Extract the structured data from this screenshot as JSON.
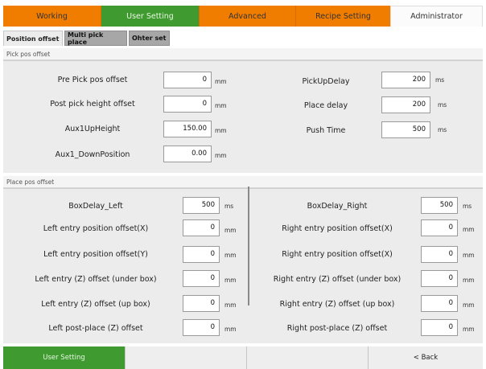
{
  "top_tabs": {
    "working": "Working",
    "user_setting": "User Setting",
    "advanced": "Advanced",
    "recipe_setting": "Recipe Setting",
    "administrator": "Administrator"
  },
  "sub_tabs": {
    "position_offset": "Position offset",
    "multi_pick_place": "Multi pick place",
    "other_set": "Ohter set"
  },
  "pick_pos": {
    "header": "Pick pos offset",
    "pre_pick": {
      "label": "Pre Pick pos offset",
      "value": "0",
      "unit": "mm"
    },
    "post_pick": {
      "label": "Post pick height offset",
      "value": "0",
      "unit": "mm"
    },
    "aux_up": {
      "label": "Aux1UpHeight",
      "value": "150.00",
      "unit": "mm"
    },
    "aux_down": {
      "label": "Aux1_DownPosition",
      "value": "0.00",
      "unit": "mm"
    },
    "pickup_delay": {
      "label": "PickUpDelay",
      "value": "200",
      "unit": "ms"
    },
    "place_delay": {
      "label": "Place delay",
      "value": "200",
      "unit": "ms"
    },
    "push_time": {
      "label": "Push Time",
      "value": "500",
      "unit": "ms"
    }
  },
  "place_pos": {
    "header": "Place pos offset",
    "left": {
      "box_delay": {
        "label": "BoxDelay_Left",
        "value": "500",
        "unit": "ms"
      },
      "entry_x": {
        "label": "Left entry position offset(X)",
        "value": "0",
        "unit": "mm"
      },
      "entry_y": {
        "label": "Left entry position offset(Y)",
        "value": "0",
        "unit": "mm"
      },
      "entry_z_under": {
        "label": "Left entry (Z) offset (under box)",
        "value": "0",
        "unit": "mm"
      },
      "entry_z_up": {
        "label": "Left entry (Z) offset (up box)",
        "value": "0",
        "unit": "mm"
      },
      "post_place_z": {
        "label": "Left post-place (Z) offset",
        "value": "0",
        "unit": "mm"
      }
    },
    "right": {
      "box_delay": {
        "label": "BoxDelay_Right",
        "value": "500",
        "unit": "ms"
      },
      "entry_x": {
        "label": "Right entry position offset(X)",
        "value": "0",
        "unit": "mm"
      },
      "entry_x2": {
        "label": "Right entry position offset(X)",
        "value": "0",
        "unit": "mm"
      },
      "entry_z_under": {
        "label": "Right entry (Z) offset (under box)",
        "value": "0",
        "unit": "mm"
      },
      "entry_z_up": {
        "label": "Right entry (Z) offset (up box)",
        "value": "0",
        "unit": "mm"
      },
      "post_place_z": {
        "label": "Right post-place (Z) offset",
        "value": "0",
        "unit": "mm"
      }
    }
  },
  "bottom_bar": {
    "user_setting": "User Setting",
    "back": "< Back"
  },
  "colors": {
    "orange": "#f07d00",
    "green": "#3f9a2f",
    "panel": "#ececec"
  }
}
